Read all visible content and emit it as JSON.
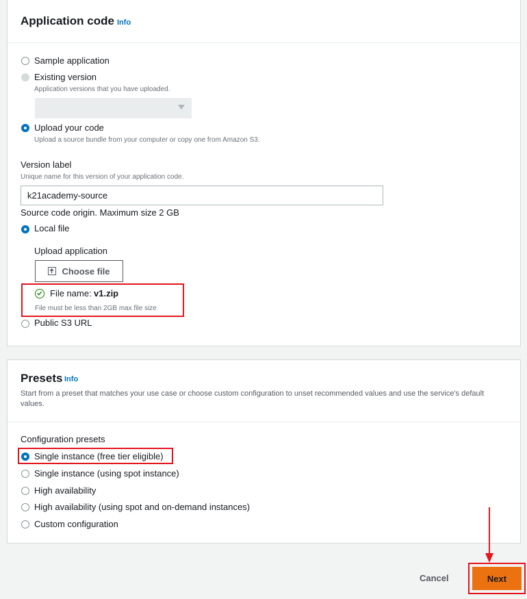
{
  "application_code": {
    "title": "Application code",
    "info": "Info",
    "options": {
      "sample": "Sample application",
      "existing": "Existing version",
      "existing_desc": "Application versions that you have uploaded.",
      "upload": "Upload your code",
      "upload_desc": "Upload a source bundle from your computer or copy one from Amazon S3."
    },
    "version_label": {
      "label": "Version label",
      "desc": "Unique name for this version of your application code.",
      "value": "k21academy-source"
    },
    "source_origin": "Source code origin. Maximum size 2 GB",
    "local_file": "Local file",
    "upload_application": "Upload application",
    "choose_file": "Choose file",
    "file_name_label": "File name:",
    "file_name_value": "v1.zip",
    "file_size_note": "File must be less than 2GB max file size",
    "public_s3": "Public S3 URL"
  },
  "presets": {
    "title": "Presets",
    "info": "Info",
    "desc": "Start from a preset that matches your use case or choose custom configuration to unset recommended values and use the service's default values.",
    "config_label": "Configuration presets",
    "options": [
      "Single instance (free tier eligible)",
      "Single instance (using spot instance)",
      "High availability",
      "High availability (using spot and on-demand instances)",
      "Custom configuration"
    ],
    "selected_index": 0
  },
  "footer": {
    "cancel": "Cancel",
    "next": "Next"
  },
  "colors": {
    "accent": "#0073bb",
    "primary_button": "#ec7211",
    "highlight": "#e3141c",
    "success": "#1d8102"
  }
}
